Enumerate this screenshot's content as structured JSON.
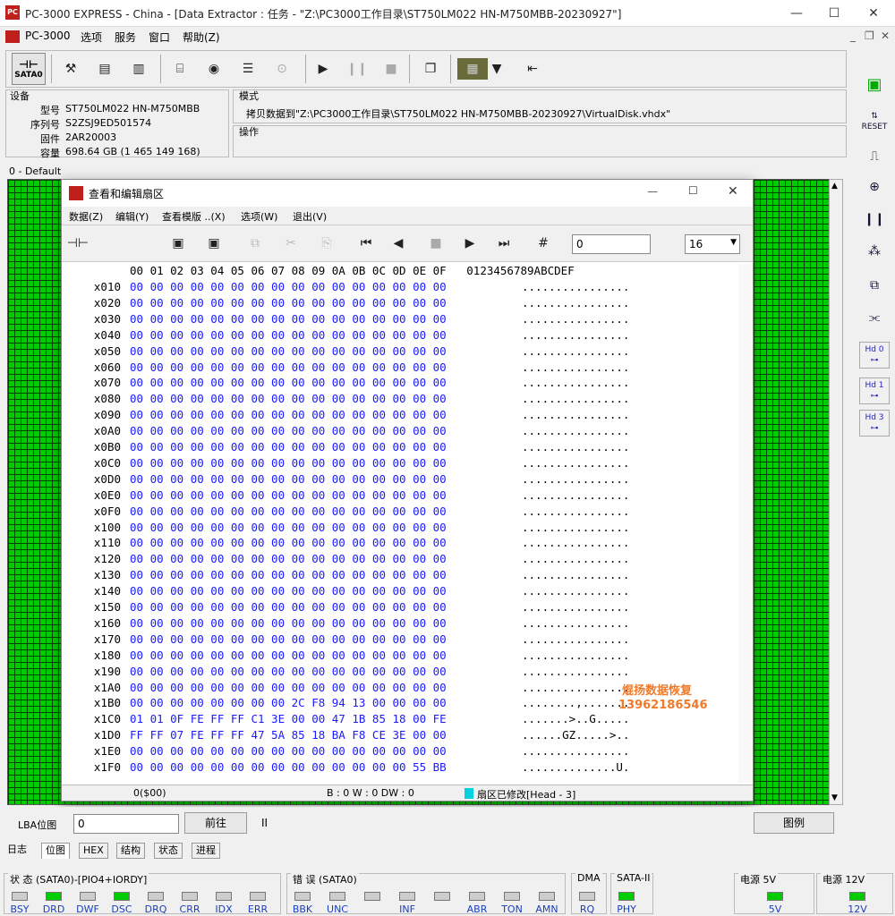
{
  "window": {
    "title": "PC-3000 EXPRESS - China - [Data Extractor : 任务 - \"Z:\\PC3000工作目录\\ST750LM022 HN-M750MBB-20230927\"]",
    "min": "—",
    "max": "☐",
    "close": "✕"
  },
  "menu": {
    "app": "PC-3000",
    "items": [
      "选项",
      "服务",
      "窗口",
      "帮助(Z)"
    ]
  },
  "toolbar": {
    "sata": "SATA0"
  },
  "device": {
    "section": "设备",
    "labels": [
      "型号",
      "序列号",
      "固件",
      "容量"
    ],
    "values": [
      "ST750LM022 HN-M750MBB",
      "S2ZSJ9ED501574",
      "2AR20003",
      "698.64 GB (1 465 149 168)"
    ]
  },
  "mode": {
    "section": "模式",
    "text": "拷贝数据到\"Z:\\PC3000工作目录\\ST750LM022 HN-M750MBB-20230927\\VirtualDisk.vhdx\"",
    "ops": "操作"
  },
  "map": {
    "label": "0 - Default"
  },
  "right_tools": {
    "reset": "RESET",
    "hd0": "Hd 0",
    "hd1": "Hd 1",
    "hd3": "Hd 3"
  },
  "dialog": {
    "title": "查看和编辑扇区",
    "menu": [
      "数据(Z)",
      "编辑(Y)",
      "查看模版 ..(X)",
      "选项(W)",
      "退出(V)"
    ],
    "offset_value": "0",
    "base_value": "16",
    "header": "00 01 02 03 04 05 06 07 08 09 0A 0B 0C 0D 0E 0F   0123456789ABCDEF",
    "status_left": "0($00)",
    "status_mid": "B : 0 W : 0 DW : 0",
    "status_right": "扇区已修改[Head - 3]"
  },
  "hexrows": [
    {
      "a": "x010",
      "h": "00 00 00 00 00 00 00 00 00 00 00 00 00 00 00 00",
      "s": "................"
    },
    {
      "a": "x020",
      "h": "00 00 00 00 00 00 00 00 00 00 00 00 00 00 00 00",
      "s": "................"
    },
    {
      "a": "x030",
      "h": "00 00 00 00 00 00 00 00 00 00 00 00 00 00 00 00",
      "s": "................"
    },
    {
      "a": "x040",
      "h": "00 00 00 00 00 00 00 00 00 00 00 00 00 00 00 00",
      "s": "................"
    },
    {
      "a": "x050",
      "h": "00 00 00 00 00 00 00 00 00 00 00 00 00 00 00 00",
      "s": "................"
    },
    {
      "a": "x060",
      "h": "00 00 00 00 00 00 00 00 00 00 00 00 00 00 00 00",
      "s": "................"
    },
    {
      "a": "x070",
      "h": "00 00 00 00 00 00 00 00 00 00 00 00 00 00 00 00",
      "s": "................"
    },
    {
      "a": "x080",
      "h": "00 00 00 00 00 00 00 00 00 00 00 00 00 00 00 00",
      "s": "................"
    },
    {
      "a": "x090",
      "h": "00 00 00 00 00 00 00 00 00 00 00 00 00 00 00 00",
      "s": "................"
    },
    {
      "a": "x0A0",
      "h": "00 00 00 00 00 00 00 00 00 00 00 00 00 00 00 00",
      "s": "................"
    },
    {
      "a": "x0B0",
      "h": "00 00 00 00 00 00 00 00 00 00 00 00 00 00 00 00",
      "s": "................"
    },
    {
      "a": "x0C0",
      "h": "00 00 00 00 00 00 00 00 00 00 00 00 00 00 00 00",
      "s": "................"
    },
    {
      "a": "x0D0",
      "h": "00 00 00 00 00 00 00 00 00 00 00 00 00 00 00 00",
      "s": "................"
    },
    {
      "a": "x0E0",
      "h": "00 00 00 00 00 00 00 00 00 00 00 00 00 00 00 00",
      "s": "................"
    },
    {
      "a": "x0F0",
      "h": "00 00 00 00 00 00 00 00 00 00 00 00 00 00 00 00",
      "s": "................"
    },
    {
      "a": "x100",
      "h": "00 00 00 00 00 00 00 00 00 00 00 00 00 00 00 00",
      "s": "................"
    },
    {
      "a": "x110",
      "h": "00 00 00 00 00 00 00 00 00 00 00 00 00 00 00 00",
      "s": "................"
    },
    {
      "a": "x120",
      "h": "00 00 00 00 00 00 00 00 00 00 00 00 00 00 00 00",
      "s": "................"
    },
    {
      "a": "x130",
      "h": "00 00 00 00 00 00 00 00 00 00 00 00 00 00 00 00",
      "s": "................"
    },
    {
      "a": "x140",
      "h": "00 00 00 00 00 00 00 00 00 00 00 00 00 00 00 00",
      "s": "................"
    },
    {
      "a": "x150",
      "h": "00 00 00 00 00 00 00 00 00 00 00 00 00 00 00 00",
      "s": "................"
    },
    {
      "a": "x160",
      "h": "00 00 00 00 00 00 00 00 00 00 00 00 00 00 00 00",
      "s": "................"
    },
    {
      "a": "x170",
      "h": "00 00 00 00 00 00 00 00 00 00 00 00 00 00 00 00",
      "s": "................"
    },
    {
      "a": "x180",
      "h": "00 00 00 00 00 00 00 00 00 00 00 00 00 00 00 00",
      "s": "................"
    },
    {
      "a": "x190",
      "h": "00 00 00 00 00 00 00 00 00 00 00 00 00 00 00 00",
      "s": "................"
    },
    {
      "a": "x1A0",
      "h": "00 00 00 00 00 00 00 00 00 00 00 00 00 00 00 00",
      "s": "................"
    },
    {
      "a": "x1B0",
      "h": "00 00 00 00 00 00 00 00 2C F8 94 13 00 00 00 00",
      "s": "........,......."
    },
    {
      "a": "x1C0",
      "h": "01 01 0F FE FF FF C1 3E 00 00 47 1B 85 18 00 FE",
      "s": ".......>..G....."
    },
    {
      "a": "x1D0",
      "h": "FF FF 07 FE FF FF 47 5A 85 18 BA F8 CE 3E 00 00",
      "s": "......GZ.....>.."
    },
    {
      "a": "x1E0",
      "h": "00 00 00 00 00 00 00 00 00 00 00 00 00 00 00 00",
      "s": "................"
    },
    {
      "a": "x1F0",
      "h": "00 00 00 00 00 00 00 00 00 00 00 00 00 00 55 BB",
      "s": "..............U."
    }
  ],
  "watermark": {
    "line1": "焜扬数据恢复",
    "line2": "13962186546"
  },
  "lba": {
    "label": "LBA位图",
    "value": "0",
    "go": "前往",
    "pause": "II",
    "legend": "图例"
  },
  "tabs": [
    "日志",
    "位图",
    "HEX",
    "结构",
    "状态",
    "进程"
  ],
  "status": {
    "g1": {
      "title": "状 态 (SATA0)-[PIO4+IORDY]",
      "leds": [
        {
          "n": "BSY",
          "on": false
        },
        {
          "n": "DRD",
          "on": true
        },
        {
          "n": "DWF",
          "on": false
        },
        {
          "n": "DSC",
          "on": true
        },
        {
          "n": "DRQ",
          "on": false
        },
        {
          "n": "CRR",
          "on": false
        },
        {
          "n": "IDX",
          "on": false
        },
        {
          "n": "ERR",
          "on": false
        }
      ]
    },
    "g2": {
      "title": "错 误 (SATA0)",
      "leds": [
        {
          "n": "BBK",
          "on": false
        },
        {
          "n": "UNC",
          "on": false
        },
        {
          "n": "",
          "on": false
        },
        {
          "n": "INF",
          "on": false
        },
        {
          "n": "",
          "on": false
        },
        {
          "n": "ABR",
          "on": false
        },
        {
          "n": "TON",
          "on": false
        },
        {
          "n": "AMN",
          "on": false
        }
      ]
    },
    "g3": {
      "title": "DMA",
      "leds": [
        {
          "n": "RQ",
          "on": false
        }
      ]
    },
    "g4": {
      "title": "SATA-II",
      "leds": [
        {
          "n": "PHY",
          "on": true
        }
      ]
    },
    "g5": {
      "title": "电源 5V",
      "leds": [
        {
          "n": "5V",
          "on": true
        }
      ]
    },
    "g6": {
      "title": "电源 12V",
      "leds": [
        {
          "n": "12V",
          "on": true
        }
      ]
    }
  }
}
